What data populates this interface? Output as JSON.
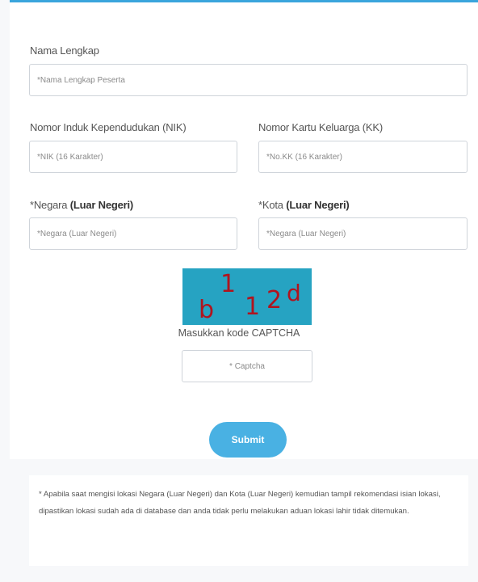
{
  "form": {
    "full_name": {
      "label": "Nama Lengkap",
      "placeholder": "*Nama Lengkap Peserta"
    },
    "nik": {
      "label": "Nomor Induk Kependudukan (NIK)",
      "placeholder": "*NIK (16 Karakter)"
    },
    "kk": {
      "label": "Nomor Kartu Keluarga (KK)",
      "placeholder": "*No.KK (16 Karakter)"
    },
    "country": {
      "label_prefix": "*Negara",
      "label_bold": "(Luar Negeri)",
      "placeholder": "*Negara (Luar Negeri)"
    },
    "city": {
      "label_prefix": "*Kota",
      "label_bold": "(Luar Negeri)",
      "placeholder": "*Negara (Luar Negeri)"
    },
    "captcha": {
      "chars": [
        "b",
        "1",
        "1",
        "2",
        "d"
      ],
      "caption": "Masukkan kode CAPTCHA",
      "placeholder": "* Captcha"
    },
    "submit_label": "Submit"
  },
  "notice": {
    "text": "* Apabila saat mengisi lokasi Negara (Luar Negeri) dan Kota (Luar Negeri) kemudian tampil rekomendasi isian lokasi, dipastikan lokasi sudah ada di database dan anda tidak perlu melakukan aduan lokasi lahir tidak ditemukan."
  },
  "colors": {
    "accent": "#49b1e3",
    "top_border": "#3aa5dc",
    "captcha_bg": "#26a3c2",
    "captcha_text": "#b0141e"
  }
}
